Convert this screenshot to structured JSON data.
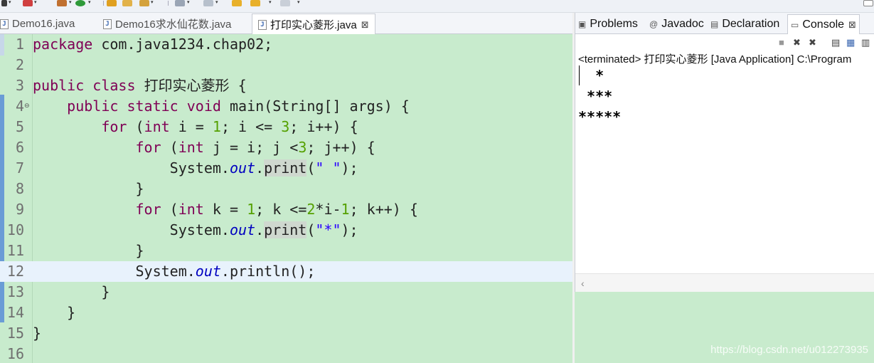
{
  "editor": {
    "tabs": [
      {
        "label": "Demo16.java",
        "active": false
      },
      {
        "label": "Demo16求水仙花数.java",
        "active": false
      },
      {
        "label": "打印实心菱形.java",
        "active": true,
        "close": "⊠"
      }
    ],
    "current_line": 12,
    "lines": [
      {
        "n": "1"
      },
      {
        "n": "2"
      },
      {
        "n": "3"
      },
      {
        "n": "4"
      },
      {
        "n": "5"
      },
      {
        "n": "6"
      },
      {
        "n": "7"
      },
      {
        "n": "8"
      },
      {
        "n": "9"
      },
      {
        "n": "10"
      },
      {
        "n": "11"
      },
      {
        "n": "12"
      },
      {
        "n": "13"
      },
      {
        "n": "14"
      },
      {
        "n": "15"
      },
      {
        "n": "16"
      }
    ],
    "code": {
      "l1": {
        "kw": "package",
        "rest": " com.java1234.chap02;"
      },
      "l3": {
        "kw1": "public",
        "kw2": "class",
        "name": "打印实心菱形",
        "brace": "{"
      },
      "l4": {
        "kw1": "public",
        "kw2": "static",
        "kw3": "void",
        "rest": "main(String[] args) {"
      },
      "l5": {
        "for": "for",
        "open": "(",
        "int": "int",
        "a": "i = ",
        "v1": "1",
        "b": "; i <= ",
        "v2": "3",
        "c": "; i++) {"
      },
      "l6": {
        "for": "for",
        "open": "(",
        "int": "int",
        "a": "j = i; j <",
        "v2": "3",
        "c": "; j++) {"
      },
      "l7": {
        "obj": "System.",
        "field": "out",
        "dot": ".",
        "method": "print",
        "open": "(",
        "str": "\" \"",
        "close": ");"
      },
      "l8": {
        "brace": "}"
      },
      "l9": {
        "for": "for",
        "open": "(",
        "int": "int",
        "a": "k = ",
        "v1": "1",
        "b": "; k <=",
        "v2": "2",
        "c": "*i-",
        "v3": "1",
        "d": "; k++) {"
      },
      "l10": {
        "obj": "System.",
        "field": "out",
        "dot": ".",
        "method": "print",
        "open": "(",
        "str": "\"*\"",
        "close": ");"
      },
      "l11": {
        "brace": "}"
      },
      "l12": {
        "obj": "System.",
        "field": "out",
        "rest": ".println();"
      },
      "l13": {
        "brace": "}"
      },
      "l14": {
        "brace": "}"
      },
      "l15": {
        "brace": "}"
      }
    }
  },
  "views": {
    "tabs": [
      {
        "label": "Problems",
        "icon": "problems-icon"
      },
      {
        "label": "Javadoc",
        "icon": "@"
      },
      {
        "label": "Declaration",
        "icon": "declaration-icon"
      },
      {
        "label": "Console",
        "icon": "console-icon",
        "active": true,
        "close": "⊠"
      }
    ]
  },
  "console": {
    "status": "<terminated> 打印实心菱形 [Java Application] C:\\Program",
    "output": [
      "  *",
      " ***",
      "*****"
    ]
  },
  "watermark": "https://blog.csdn.net/u012273935",
  "colors": {
    "editor_bg": "#c8ebcd",
    "current_line": "#e8f2fc",
    "keyword": "#7f0055",
    "number": "#54a000",
    "string": "#2a00ff",
    "field": "#0000c0"
  }
}
